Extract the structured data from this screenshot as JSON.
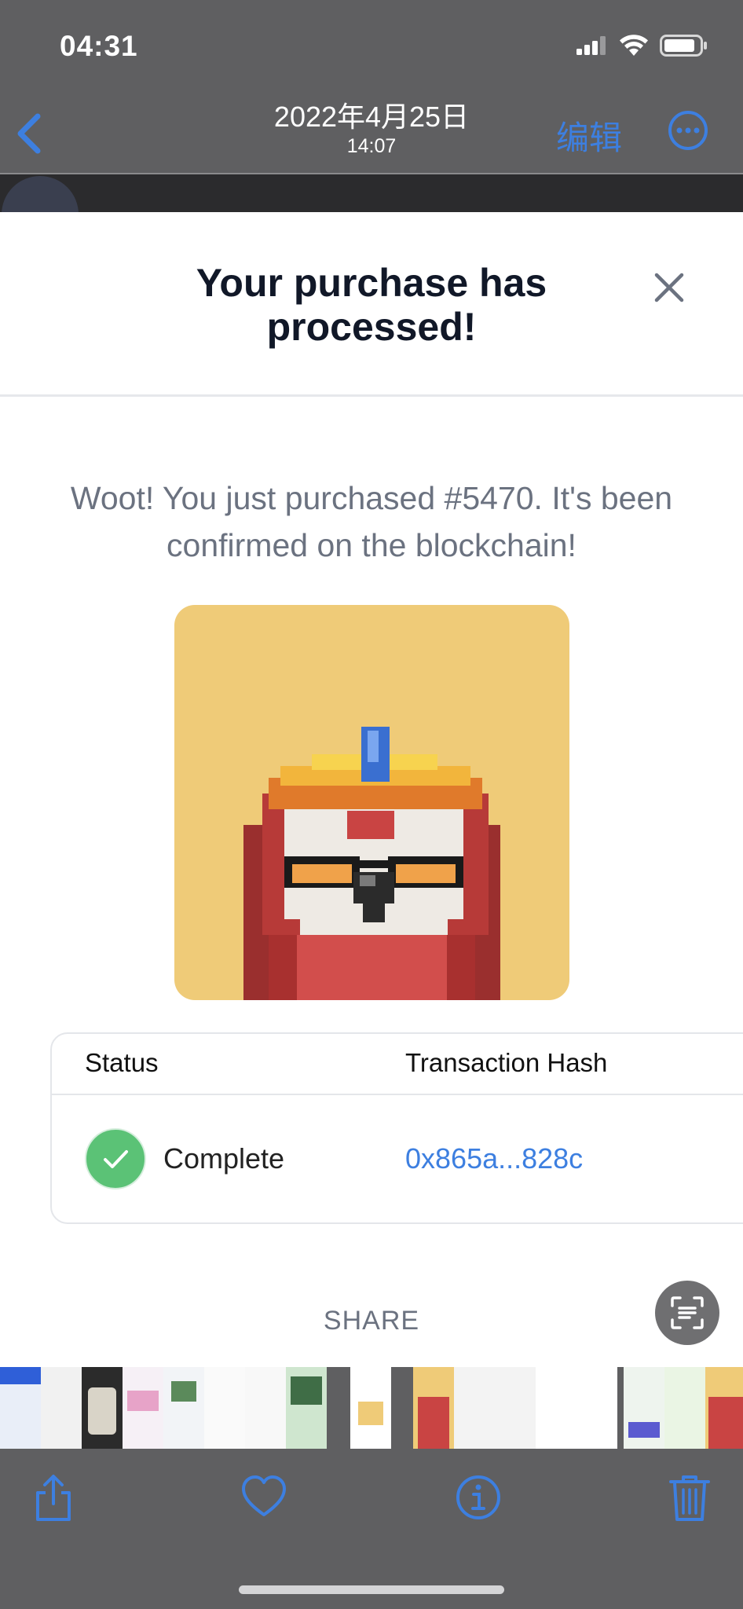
{
  "status_bar": {
    "time": "04:31"
  },
  "nav": {
    "date": "2022年4月25日",
    "time": "14:07",
    "edit_label": "编辑"
  },
  "modal": {
    "title": "Your purchase has processed!",
    "message": "Woot! You just purchased #5470. It's been confirmed on the blockchain!",
    "status_header": "Status",
    "hash_header": "Transaction Hash",
    "status_value": "Complete",
    "hash_value": "0x865a...828c",
    "share_label": "SHARE"
  },
  "colors": {
    "accent": "#3d7fe0",
    "success": "#5bc276",
    "nft_background": "#efcb78",
    "chrome": "#5f5f61"
  },
  "icons": [
    "back-icon",
    "more-icon",
    "close-icon",
    "check-icon",
    "scan-text-icon",
    "share-icon",
    "heart-icon",
    "info-icon",
    "trash-icon"
  ]
}
